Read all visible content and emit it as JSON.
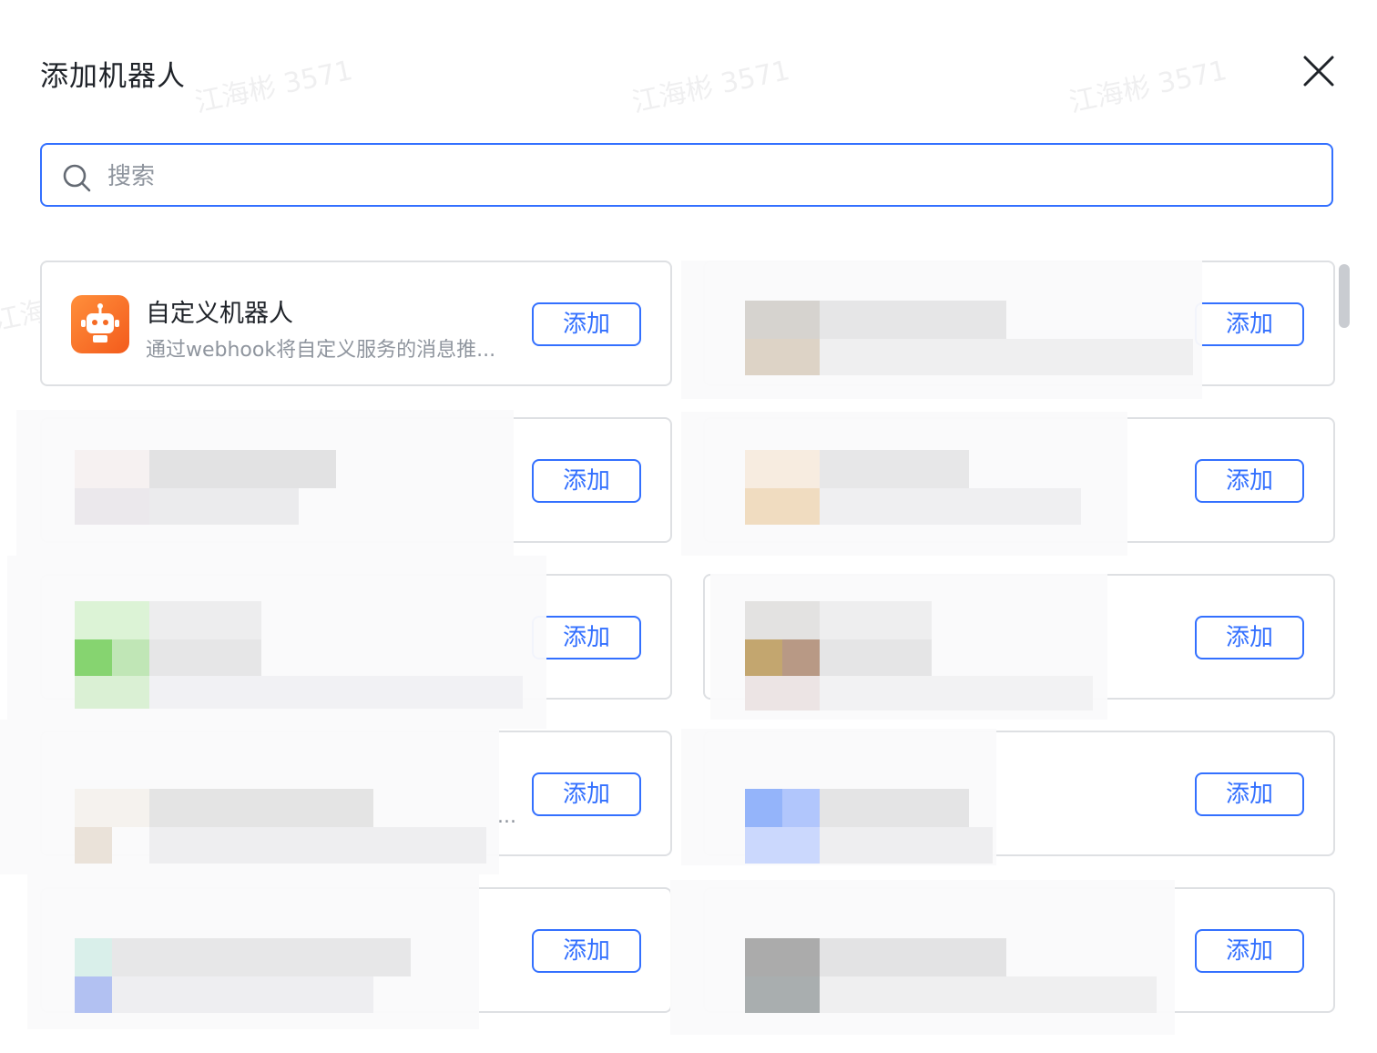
{
  "dialog": {
    "title": "添加机器人",
    "close_icon": "close-icon",
    "search": {
      "placeholder": "搜索",
      "value": "",
      "icon": "search-icon"
    }
  },
  "watermark": "江海彬 3571",
  "robots": [
    {
      "name": "自定义机器人",
      "desc": "通过webhook将自定义服务的消息推...",
      "action": "添加",
      "icon": "robot-icon",
      "icon_color": "#f56a24"
    },
    {
      "name": "",
      "desc": "",
      "action": "添加"
    },
    {
      "name": "",
      "desc": "",
      "action": "添加"
    },
    {
      "name": "",
      "desc": "",
      "action": "添加"
    },
    {
      "name": "",
      "desc": "",
      "action": "添加"
    },
    {
      "name": "",
      "desc": "",
      "action": "添加"
    },
    {
      "name": "",
      "desc": "...",
      "action": "添加"
    },
    {
      "name": "",
      "desc": "",
      "action": "添加"
    },
    {
      "name": "",
      "desc": "",
      "action": "添加"
    },
    {
      "name": "",
      "desc": "",
      "action": "添加"
    }
  ],
  "colors": {
    "accent": "#3370ff",
    "border": "#dee0e3",
    "muted_text": "#8f959e"
  }
}
